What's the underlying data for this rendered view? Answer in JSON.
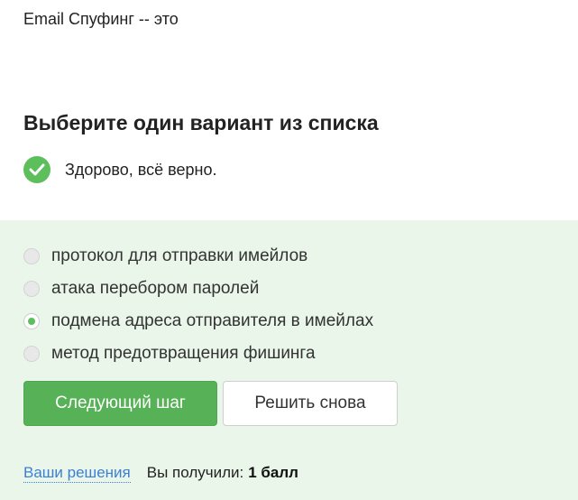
{
  "question": {
    "text": "Email Спуфинг -- это"
  },
  "task": {
    "title": "Выберите один вариант из списка"
  },
  "feedback": {
    "icon": "check-circle-icon",
    "text": "Здорово, всё верно.",
    "color": "#5cbf5c"
  },
  "options": [
    {
      "label": "протокол для отправки имейлов",
      "selected": false
    },
    {
      "label": "атака перебором паролей",
      "selected": false
    },
    {
      "label": "подмена адреса отправителя в имейлах",
      "selected": true
    },
    {
      "label": "метод предотвращения фишинга",
      "selected": false
    }
  ],
  "buttons": {
    "next_label": "Следующий шаг",
    "retry_label": "Решить снова"
  },
  "footer": {
    "solutions_link": "Ваши решения",
    "score_label": "Вы получили:",
    "score_value": "1 балл"
  },
  "colors": {
    "accent": "#5cbf5c",
    "panel_background": "#e9f6e9",
    "link": "#3d7fd6"
  }
}
